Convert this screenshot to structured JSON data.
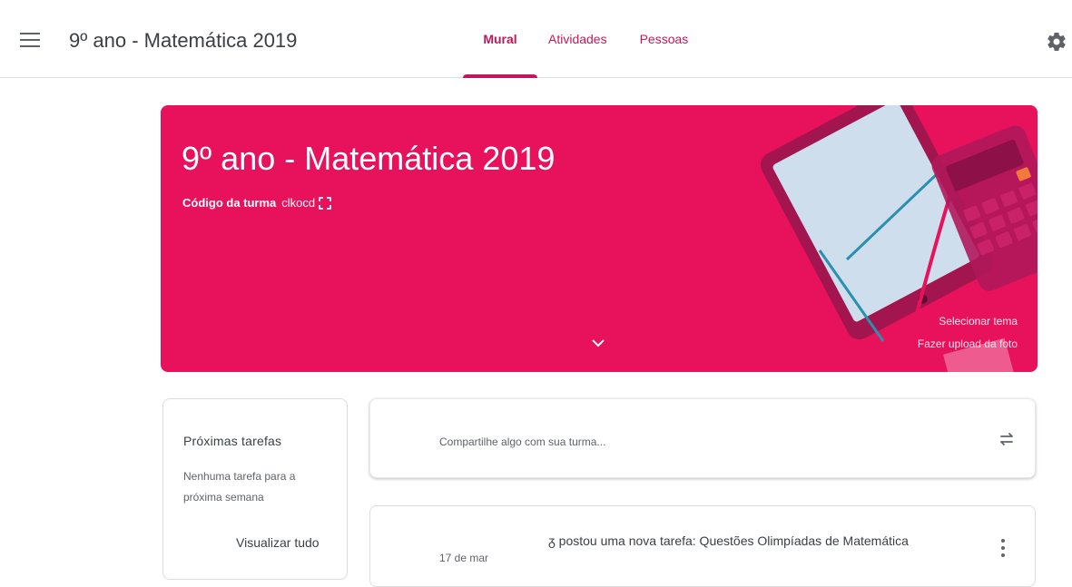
{
  "header": {
    "class_title": "9º ano - Matemática 2019",
    "tabs": [
      {
        "label": "Mural",
        "active": true
      },
      {
        "label": "Atividades",
        "active": false
      },
      {
        "label": "Pessoas",
        "active": false
      }
    ],
    "icons": {
      "menu": "hamburger-menu-icon",
      "settings": "gear-icon"
    }
  },
  "banner": {
    "title": "9º ano - Matemática 2019",
    "code_label": "Código da turma",
    "code_value": "clkocd",
    "select_theme": "Selecionar tema",
    "upload_photo": "Fazer upload da foto",
    "color": "#e8125c"
  },
  "upcoming": {
    "title": "Próximas tarefas",
    "empty_text": "Nenhuma tarefa para a próxima semana",
    "view_all": "Visualizar tudo"
  },
  "share": {
    "placeholder": "Compartilhe algo com sua turma..."
  },
  "post": {
    "text": "ᵹ postou uma nova tarefa: Questões Olimpíadas de Matemática",
    "date": "17 de mar"
  },
  "colors": {
    "accent": "#c2185b",
    "banner": "#e8125c"
  }
}
